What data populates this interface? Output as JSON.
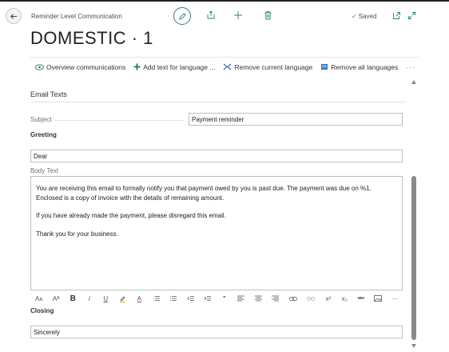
{
  "header": {
    "caption": "Reminder Level Communication",
    "title": "DOMESTIC · 1",
    "saved_label": "Saved",
    "saved_check": "✓"
  },
  "actions": [
    {
      "label": "Overview communications",
      "icon": "eye-icon"
    },
    {
      "label": "Add text for language ...",
      "icon": "plus-icon"
    },
    {
      "label": "Remove current language",
      "icon": "remove-language-icon"
    },
    {
      "label": "Remove all languages",
      "icon": "remove-all-icon"
    }
  ],
  "actions_more": "···",
  "section": {
    "title": "Email Texts"
  },
  "fields": {
    "subject_label": "Subject",
    "subject_value": "Payment reminder",
    "greeting_label": "Greeting",
    "greeting_value": "Dear",
    "body_label": "Body Text",
    "body_paragraphs": [
      "You are receiving this email to formally notify you that payment owed by you is past due. The payment was due on %1. Enclosed is a copy of invoice with the details of remaining amount.",
      "If you have already made the payment, please disregard this email.",
      "Thank you for your business."
    ],
    "closing_label": "Closing",
    "closing_value": "Sincerely"
  },
  "rte_toolbar": {
    "font_size": "Aᴀ",
    "font": "Aᴬ",
    "bold": "B",
    "italic": "/",
    "underline": "U",
    "highlight": "highlight-icon",
    "font_color": "A",
    "bullets": "bullet-list-icon",
    "numbers": "numbered-list-icon",
    "outdent": "outdent-icon",
    "indent": "indent-icon",
    "quote": "”",
    "align_left": "align-left-icon",
    "align_center": "align-center-icon",
    "align_right": "align-right-icon",
    "link": "link-icon",
    "unlink": "unlink-icon",
    "superscript": "x²",
    "subscript": "x₂",
    "strikethrough": "abc",
    "image": "image-icon",
    "more": "···"
  },
  "colors": {
    "accent": "#2f7d7d",
    "icon_green": "#1f7a5a",
    "icon_blue": "#2f6fb3",
    "scroll_thumb": "#8a8a8a"
  }
}
